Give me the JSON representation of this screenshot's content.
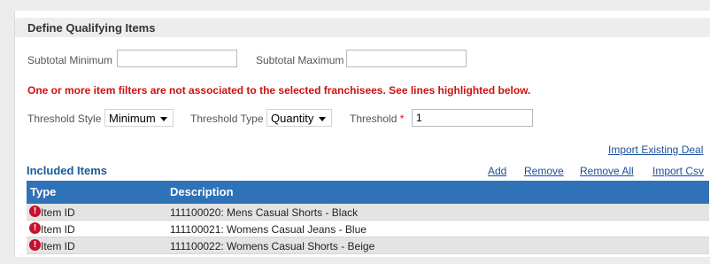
{
  "section": {
    "title": "Define Qualifying Items"
  },
  "subtotal": {
    "min_label": "Subtotal Minimum",
    "min_value": "",
    "max_label": "Subtotal Maximum",
    "max_value": ""
  },
  "error_message": "One or more item filters are not associated to the selected franchisees. See lines highlighted below.",
  "threshold": {
    "style_label": "Threshold Style",
    "style_value": "Minimum",
    "type_label": "Threshold Type",
    "type_value": "Quantity",
    "threshold_label": "Threshold",
    "required_mark": "*",
    "threshold_value": "1"
  },
  "links": {
    "import_existing_deal": "Import Existing Deal",
    "add": "Add",
    "remove": "Remove",
    "remove_all": "Remove All",
    "import_csv": "Import Csv"
  },
  "included_items": {
    "title": "Included Items",
    "columns": [
      "Type",
      "Description"
    ],
    "rows": [
      {
        "type": "Item ID",
        "description": "111100020: Mens Casual Shorts - Black",
        "error_icon": "!"
      },
      {
        "type": "Item ID",
        "description": "111100021: Womens Casual Jeans - Blue",
        "error_icon": "!"
      },
      {
        "type": "Item ID",
        "description": "111100022: Womens Casual Shorts - Beige",
        "error_icon": "!"
      }
    ]
  },
  "colors": {
    "header_blue": "#2f72b8",
    "link_blue": "#1a4f9c",
    "error_red": "#cc1111"
  }
}
